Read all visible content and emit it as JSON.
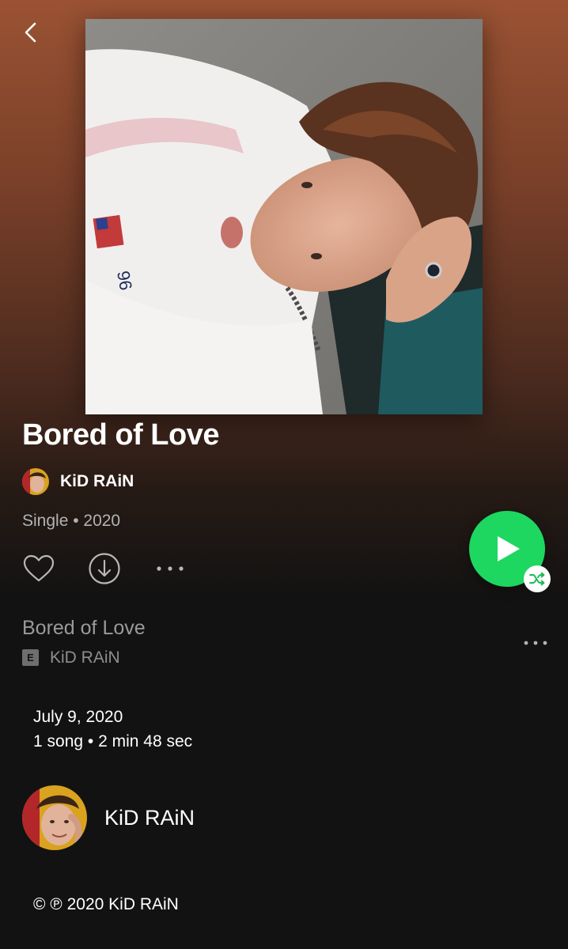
{
  "icons": {
    "back": "chevron-left-icon",
    "like": "heart-outline-icon",
    "download": "download-circle-icon",
    "more": "more-horizontal-icon",
    "play": "play-icon",
    "shuffle": "shuffle-icon"
  },
  "colors": {
    "accent": "#1ed760",
    "background": "#121212",
    "header_gradient_top": "#9a5233",
    "muted_text": "#b3b3b3"
  },
  "album": {
    "title": "Bored of Love",
    "artist": "KiD RAiN",
    "meta": "Single • 2020"
  },
  "tracks": [
    {
      "title": "Bored of Love",
      "explicit_label": "E",
      "artist": "KiD RAiN"
    }
  ],
  "details": {
    "release_date": "July 9, 2020",
    "song_info": "1 song • 2 min 48 sec"
  },
  "artist_card": {
    "name": "KiD RAiN"
  },
  "copyright": "© ℗ 2020 KiD RAiN"
}
